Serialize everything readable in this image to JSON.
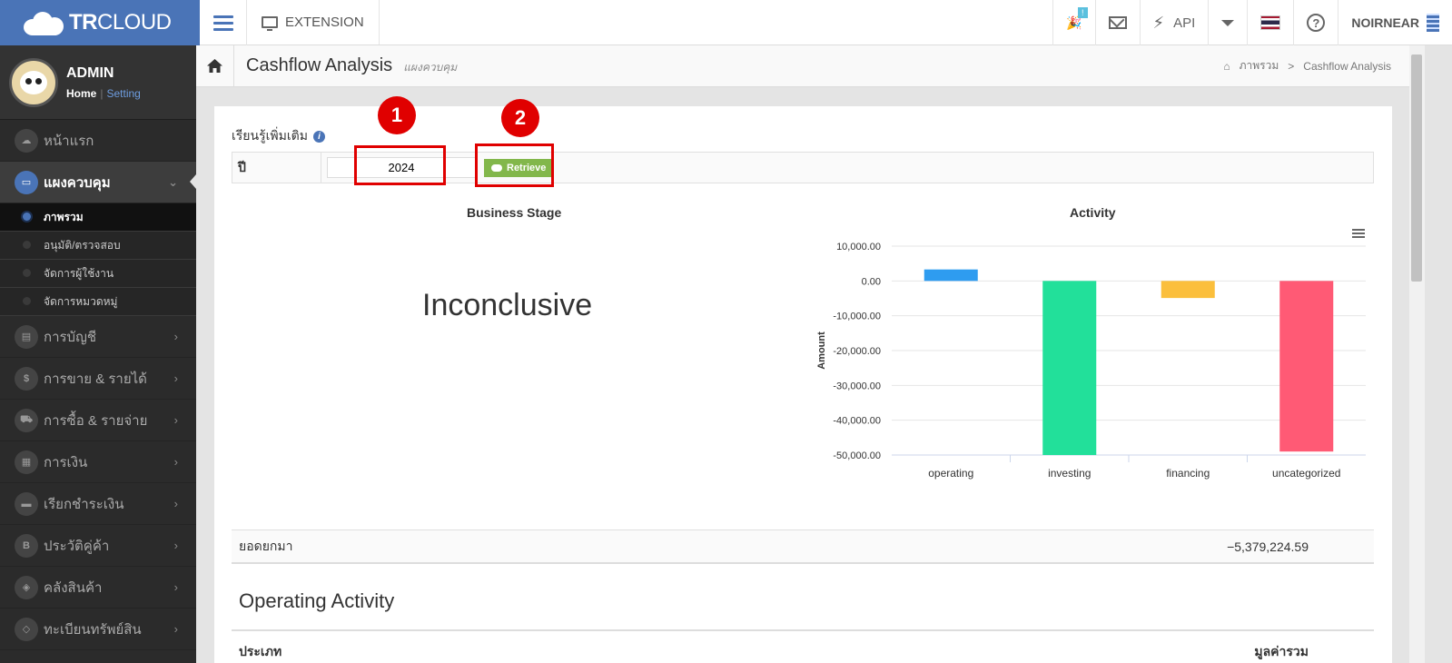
{
  "topbar": {
    "logo_bold": "TR",
    "logo_rest": "CLOUD",
    "extension_label": "EXTENSION",
    "notif_badge": "!",
    "api_label": "API",
    "company_name": "NOIRNEAR"
  },
  "sidebar": {
    "user_name": "ADMIN",
    "home_link": "Home",
    "link_separator": "|",
    "setting_link": "Setting",
    "items": [
      {
        "label": "หน้าแรก",
        "icon": "cloud-icon"
      },
      {
        "label": "แผงควบคุม",
        "icon": "monitor-icon",
        "active": true
      },
      {
        "label": "การบัญชี",
        "icon": "book-icon"
      },
      {
        "label": "การขาย & รายได้",
        "icon": "dollar-icon"
      },
      {
        "label": "การซื้อ & รายจ่าย",
        "icon": "cart-icon"
      },
      {
        "label": "การเงิน",
        "icon": "calendar-icon"
      },
      {
        "label": "เรียกชำระเงิน",
        "icon": "card-icon"
      },
      {
        "label": "ประวัติคู่ค้า",
        "icon": "contact-icon"
      },
      {
        "label": "คลังสินค้า",
        "icon": "boxes-icon"
      },
      {
        "label": "ทะเบียนทรัพย์สิน",
        "icon": "diamond-icon"
      }
    ],
    "sub_items": [
      {
        "label": "ภาพรวม",
        "current": true
      },
      {
        "label": "อนุมัติ/ตรวจสอบ"
      },
      {
        "label": "จัดการผู้ใช้งาน"
      },
      {
        "label": "จัดการหมวดหมู่"
      }
    ]
  },
  "header": {
    "title": "Cashflow Analysis",
    "subtitle": "แผงควบคุม",
    "breadcrumb": [
      "ภาพรวม",
      "Cashflow Analysis"
    ],
    "breadcrumb_sep": ">"
  },
  "filter": {
    "learn_more": "เรียนรู้เพิ่มเติม",
    "year_label": "ปี",
    "year_value": "2024",
    "retrieve_label": "Retrieve"
  },
  "annotations": [
    "1",
    "2"
  ],
  "business_stage": {
    "title": "Business Stage",
    "value": "Inconclusive"
  },
  "chart_data": {
    "type": "bar",
    "title": "Activity",
    "ylabel": "Amount",
    "xlabel": "",
    "categories": [
      "operating",
      "investing",
      "financing",
      "uncategorized"
    ],
    "values": [
      3300,
      -50000,
      -4900,
      -49000
    ],
    "colors": [
      "#2e9cf0",
      "#22e09a",
      "#fbbf3c",
      "#ff5a75"
    ],
    "ylim": [
      -50000,
      10000
    ],
    "yticks": [
      "10,000.00",
      "0.00",
      "-10,000.00",
      "-20,000.00",
      "-30,000.00",
      "-40,000.00",
      "-50,000.00"
    ],
    "grid": true
  },
  "summary": {
    "carry_label": "ยอดยกมา",
    "carry_value": "−5,379,224.59",
    "operating_title": "Operating Activity",
    "col_type": "ประเภท",
    "col_total": "มูลค่ารวม"
  }
}
